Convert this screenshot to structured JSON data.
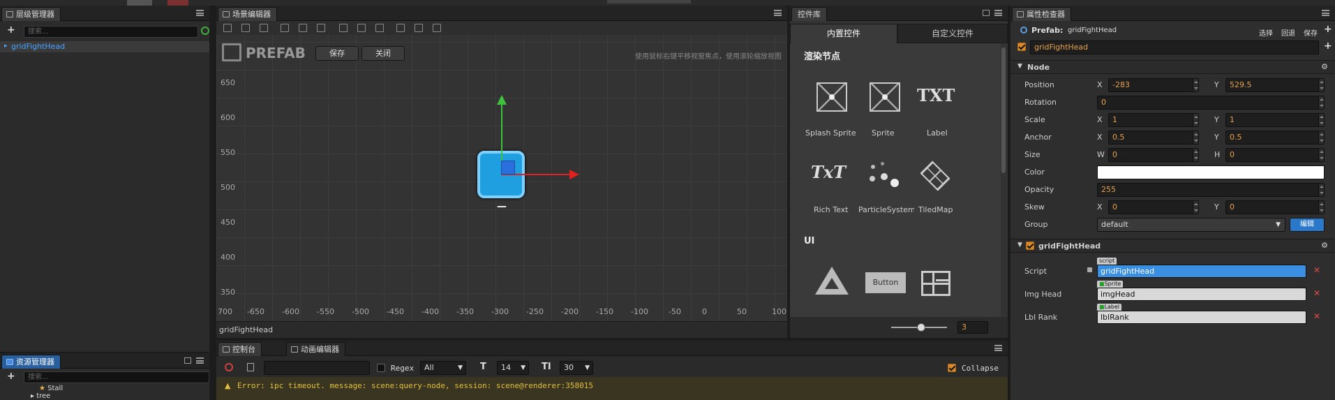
{
  "hierarchy": {
    "title": "层级管理器",
    "search_placeholder": "搜索...",
    "root_item": "gridFightHead"
  },
  "assets": {
    "title": "资源管理器",
    "search_placeholder": "搜索...",
    "items": [
      "Stall",
      "tree"
    ]
  },
  "scene": {
    "title": "场景编辑器",
    "prefab_label": "PREFAB",
    "save_label": "保存",
    "close_label": "关闭",
    "hint": "使用鼠标右键平移视窗焦点，使用滚轮缩放视图",
    "node_label": "gridFightHead",
    "y_ticks": [
      "650",
      "600",
      "550",
      "500",
      "450",
      "400",
      "350"
    ],
    "x_ticks": [
      "700",
      "-650",
      "-600",
      "-550",
      "-500",
      "-450",
      "-400",
      "-350",
      "-300",
      "-250",
      "-200",
      "-150",
      "-100",
      "-50",
      "0",
      "50",
      "100"
    ],
    "node_caption": "—"
  },
  "library": {
    "title": "控件库",
    "tabs": [
      "内置控件",
      "自定义控件"
    ],
    "section_render": "渲染节点",
    "render_items": [
      "Splash Sprite",
      "Sprite",
      "Label",
      "Rich Text",
      "ParticleSystem",
      "TiledMap"
    ],
    "section_ui": "UI",
    "ui_items": [
      "Canvas",
      "Button",
      "Layout"
    ],
    "txt_glyph": "TXT",
    "richtext_glyph": "TxT",
    "button_glyph": "Button",
    "zoom_value": "3"
  },
  "console": {
    "tabs": [
      "控制台",
      "动画编辑器"
    ],
    "regex_label": "Regex",
    "level": "All",
    "font_size": "14",
    "line_height": "30",
    "collapse_label": "Collapse",
    "error": "Error: ipc timeout. message: scene:query-node, session: scene@renderer:358015"
  },
  "inspector": {
    "title": "属性检查器",
    "prefab_label": "Prefab:",
    "prefab_name": "gridFightHead",
    "actions": [
      "选择",
      "回退",
      "保存"
    ],
    "node_name": "gridFightHead",
    "section_node": "Node",
    "properties": {
      "position": {
        "label": "Position",
        "x": "-283",
        "y": "529.5"
      },
      "rotation": {
        "label": "Rotation",
        "value": "0"
      },
      "scale": {
        "label": "Scale",
        "x": "1",
        "y": "1"
      },
      "anchor": {
        "label": "Anchor",
        "x": "0.5",
        "y": "0.5"
      },
      "size": {
        "label": "Size",
        "w": "0",
        "h": "0"
      },
      "color": {
        "label": "Color",
        "value": "#ffffff"
      },
      "opacity": {
        "label": "Opacity",
        "value": "255"
      },
      "skew": {
        "label": "Skew",
        "x": "0",
        "y": "0"
      },
      "group": {
        "label": "Group",
        "value": "default",
        "edit_label": "编辑"
      }
    },
    "component": {
      "name": "gridFightHead",
      "script_label": "Script",
      "script_tag": "script",
      "script_value": "gridFightHead",
      "img_label": "Img Head",
      "img_tag": "Sprite",
      "img_value": "imgHead",
      "lbl_label": "Lbl Rank",
      "lbl_tag": "Label",
      "lbl_value": "lblRank"
    },
    "axis_x": "X",
    "axis_y": "Y",
    "axis_w": "W",
    "axis_h": "H"
  },
  "colors": {
    "accent": "#3b8ed9",
    "orange": "#e8a14a",
    "error": "#e2c040"
  }
}
